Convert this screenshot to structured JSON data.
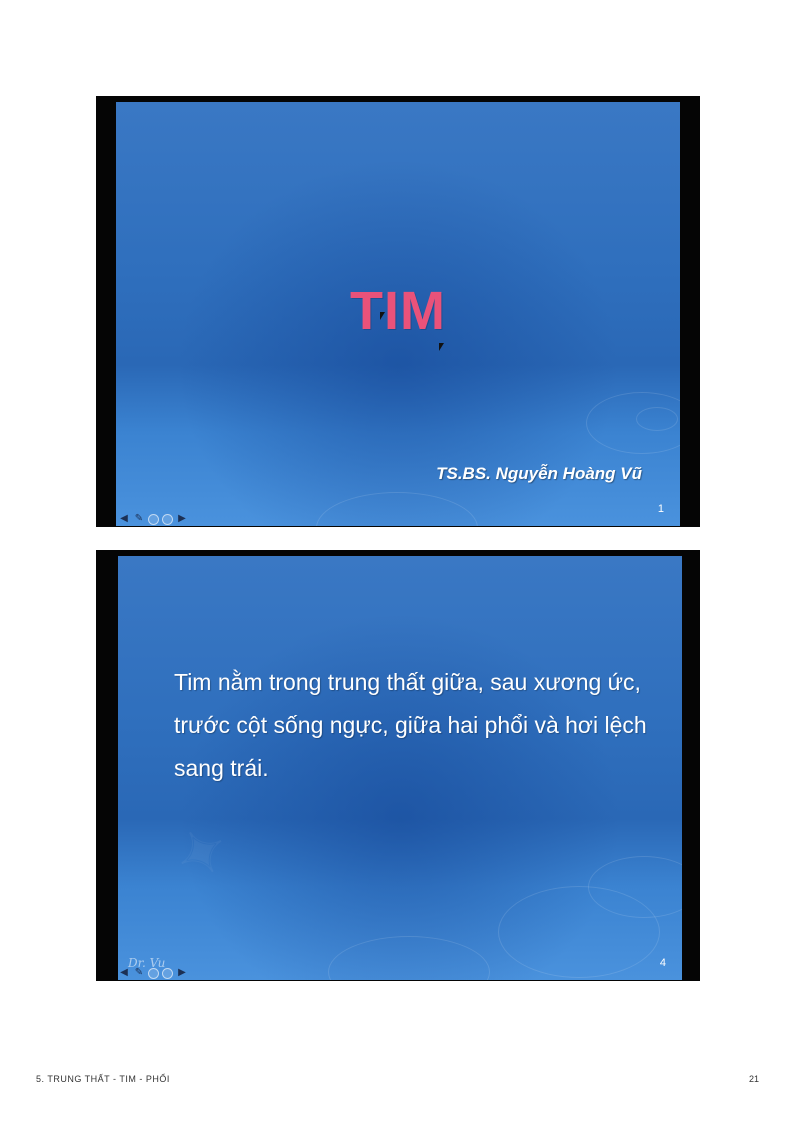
{
  "slides": [
    {
      "title": "TIM",
      "author": "TS.BS. Nguyễn Hoàng Vũ",
      "number": "1"
    },
    {
      "body": "Tim nằm trong trung thất giữa, sau xương ức, trước cột sống ngực, giữa hai phổi và hơi lệch sang trái.",
      "logo_text": "Dr. Vu",
      "number": "4"
    }
  ],
  "navigation": {
    "prev_icon": "arrow-left-icon",
    "pen_icon": "pen-icon",
    "menu_icon": "menu-circle-icon",
    "next_icon": "arrow-right-icon"
  },
  "footer": {
    "section": "5. TRUNG THẤT - TIM - PHỔI",
    "page": "21"
  },
  "colors": {
    "title": "#e9527a",
    "slide_bg": "#2f6fbd"
  }
}
